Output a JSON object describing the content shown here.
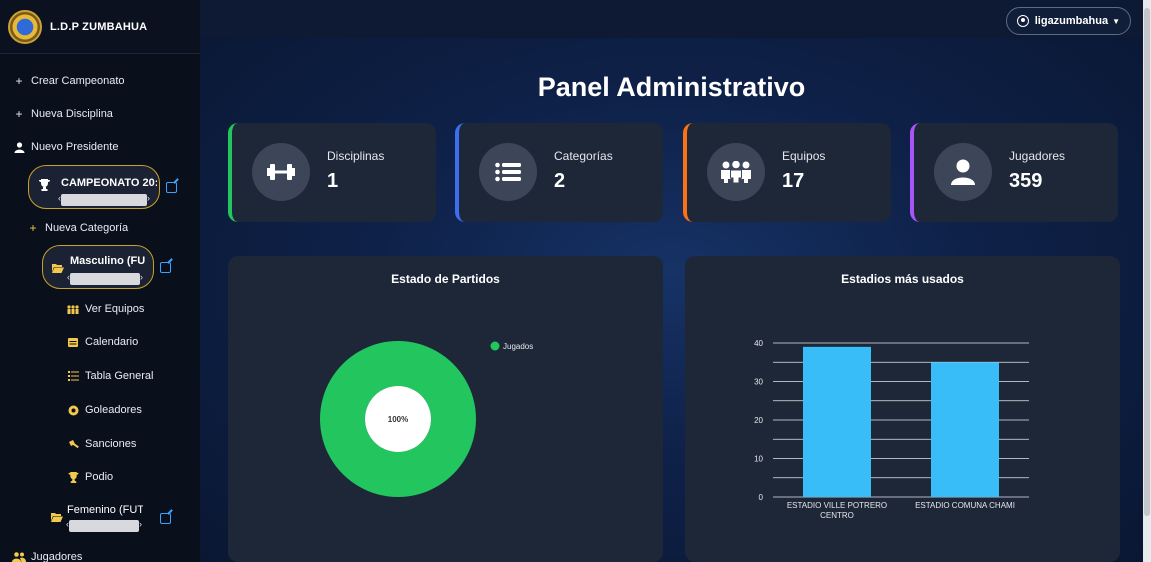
{
  "brand": {
    "name": "L.D.P ZUMBAHUA",
    "logo_text": "LDP"
  },
  "sidebar": {
    "create_championship": "Crear Campeonato",
    "new_discipline": "Nueva Disciplina",
    "new_president": "Nuevo Presidente",
    "championship": "CAMPEONATO 20:",
    "new_category": "Nueva Categoría",
    "category_male": "Masculino (FU",
    "sub_items": [
      {
        "label": "Ver Equipos",
        "icon": "teams-icon"
      },
      {
        "label": "Calendario",
        "icon": "calendar-icon"
      },
      {
        "label": "Tabla General",
        "icon": "standings-icon"
      },
      {
        "label": "Goleadores",
        "icon": "soccer-ball-icon"
      },
      {
        "label": "Sanciones",
        "icon": "sanctions-icon"
      },
      {
        "label": "Podio",
        "icon": "trophy-icon"
      }
    ],
    "category_female": "Femenino (FUT",
    "players": "Jugadores"
  },
  "topbar": {
    "user": "ligazumbahua"
  },
  "main": {
    "title": "Panel Administrativo",
    "stats": [
      {
        "label": "Disciplinas",
        "value": "1",
        "color": "#22c55e",
        "icon": "dumbbell-icon"
      },
      {
        "label": "Categorías",
        "value": "2",
        "color": "#3b6ff0",
        "icon": "list-icon"
      },
      {
        "label": "Equipos",
        "value": "17",
        "color": "#f97316",
        "icon": "team-icon"
      },
      {
        "label": "Jugadores",
        "value": "359",
        "color": "#a855f7",
        "icon": "user-icon"
      }
    ]
  },
  "chart_data": [
    {
      "type": "pie",
      "title": "Estado de Partidos",
      "labels": [
        "Jugados"
      ],
      "values": [
        100
      ],
      "data_labels": [
        "100%"
      ],
      "colors": [
        "#22c55e"
      ],
      "legend": "top-right"
    },
    {
      "type": "bar",
      "title": "Estadios más usados",
      "categories": [
        [
          "ESTADIO VILLE POTRERO",
          "CENTRO"
        ],
        [
          "ESTADIO COMUNA CHAMI"
        ]
      ],
      "values": [
        39,
        35
      ],
      "ylim": [
        0,
        40
      ],
      "yticks": [
        "0",
        "10",
        "20",
        "30",
        "40"
      ],
      "color": "#38bdf8",
      "grid": true
    }
  ]
}
